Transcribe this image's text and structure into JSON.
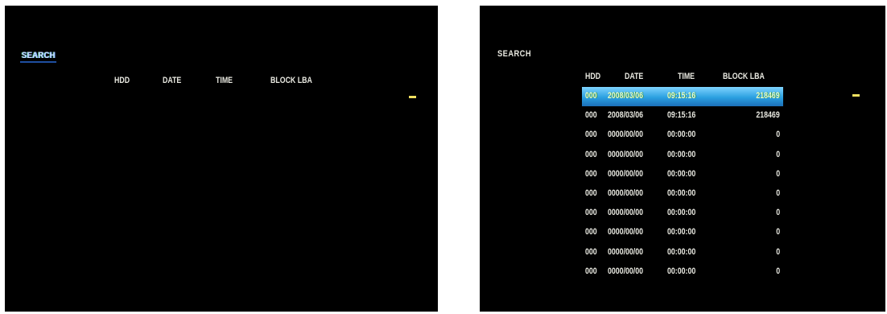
{
  "screens": [
    {
      "title": "SEARCH",
      "headers": {
        "hdd": "HDD",
        "date": "DATE",
        "time": "TIME",
        "block": "BLOCK LBA"
      },
      "rows": []
    },
    {
      "title": "SEARCH",
      "headers": {
        "hdd": "HDD",
        "date": "DATE",
        "time": "TIME",
        "block": "BLOCK LBA"
      },
      "rows": [
        {
          "hdd": "000",
          "date": "2008/03/06",
          "time": "09:15:16",
          "lba": "218469",
          "selected": true
        },
        {
          "hdd": "000",
          "date": "2008/03/06",
          "time": "09:15:16",
          "lba": "218469",
          "selected": false
        },
        {
          "hdd": "000",
          "date": "0000/00/00",
          "time": "00:00:00",
          "lba": "0",
          "selected": false
        },
        {
          "hdd": "000",
          "date": "0000/00/00",
          "time": "00:00:00",
          "lba": "0",
          "selected": false
        },
        {
          "hdd": "000",
          "date": "0000/00/00",
          "time": "00:00:00",
          "lba": "0",
          "selected": false
        },
        {
          "hdd": "000",
          "date": "0000/00/00",
          "time": "00:00:00",
          "lba": "0",
          "selected": false
        },
        {
          "hdd": "000",
          "date": "0000/00/00",
          "time": "00:00:00",
          "lba": "0",
          "selected": false
        },
        {
          "hdd": "000",
          "date": "0000/00/00",
          "time": "00:00:00",
          "lba": "0",
          "selected": false
        },
        {
          "hdd": "000",
          "date": "0000/00/00",
          "time": "00:00:00",
          "lba": "0",
          "selected": false
        },
        {
          "hdd": "000",
          "date": "0000/00/00",
          "time": "00:00:00",
          "lba": "0",
          "selected": false
        }
      ]
    }
  ],
  "colors": {
    "background": "#000000",
    "text": "#e8e8e0",
    "selection_top": "#7fd4ff",
    "selection_bottom": "#1b6fb8",
    "cursor": "#f0e060"
  }
}
